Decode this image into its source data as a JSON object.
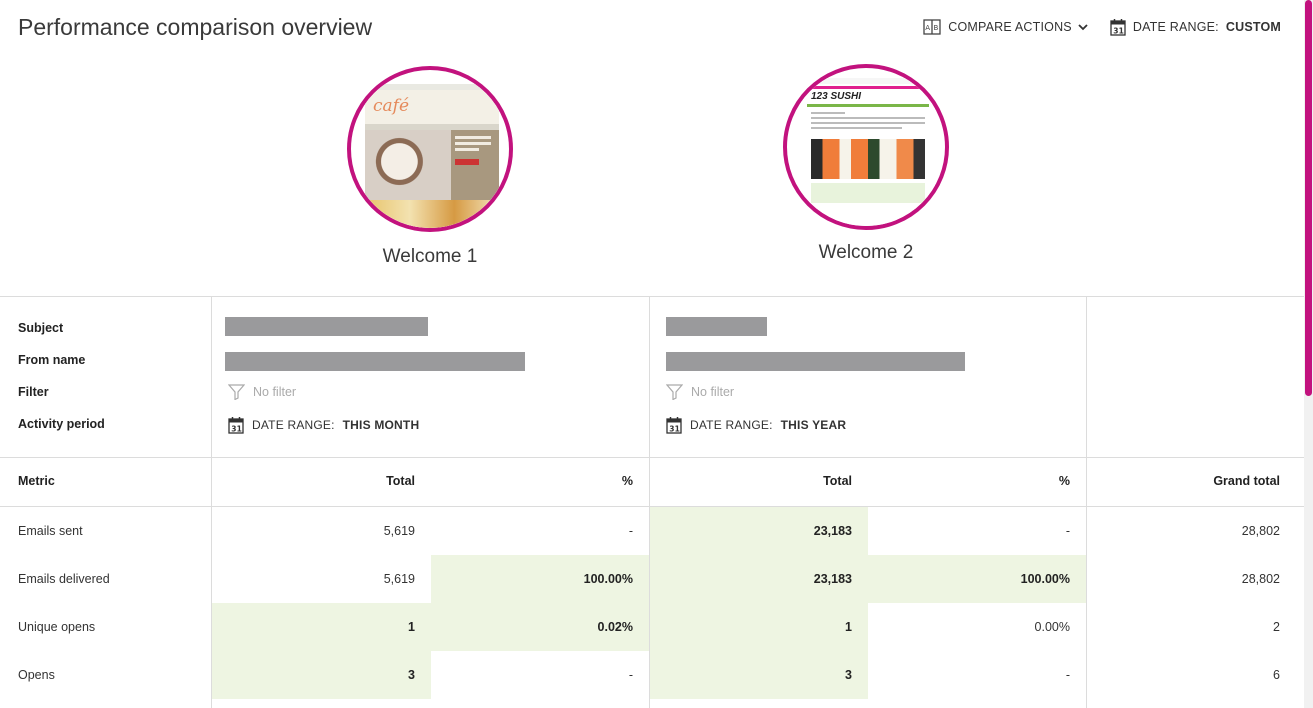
{
  "page": {
    "title": "Performance comparison overview"
  },
  "header": {
    "compare_actions_label": "COMPARE ACTIONS",
    "date_range_label": "DATE RANGE:",
    "date_range_value": "CUSTOM"
  },
  "calendar_day": "31",
  "campaigns": [
    {
      "name": "Welcome 1",
      "thumb_logo": "café"
    },
    {
      "name": "Welcome 2",
      "thumb_logo": "123 SUSHI"
    }
  ],
  "details": {
    "labels": {
      "subject": "Subject",
      "from_name": "From name",
      "filter": "Filter",
      "activity_period": "Activity period"
    },
    "campaigns": [
      {
        "filter": "No filter",
        "date_range_label": "DATE RANGE:",
        "date_range_value": "THIS MONTH"
      },
      {
        "filter": "No filter",
        "date_range_label": "DATE RANGE:",
        "date_range_value": "THIS YEAR"
      }
    ]
  },
  "table": {
    "headers": {
      "metric": "Metric",
      "total1": "Total",
      "pct1": "%",
      "total2": "Total",
      "pct2": "%",
      "grand_total": "Grand total"
    },
    "rows": [
      {
        "metric": "Emails sent",
        "total1": "5,619",
        "pct1": "-",
        "total2": "23,183",
        "pct2": "-",
        "grand": "28,802"
      },
      {
        "metric": "Emails delivered",
        "total1": "5,619",
        "pct1": "100.00%",
        "total2": "23,183",
        "pct2": "100.00%",
        "grand": "28,802"
      },
      {
        "metric": "Unique opens",
        "total1": "1",
        "pct1": "0.02%",
        "total2": "1",
        "pct2": "0.00%",
        "grand": "2"
      },
      {
        "metric": "Opens",
        "total1": "3",
        "pct1": "-",
        "total2": "3",
        "pct2": "-",
        "grand": "6"
      }
    ]
  },
  "colors": {
    "accent": "#c2127e",
    "highlight": "#eef5e2",
    "redacted": "#9a9a9c"
  }
}
